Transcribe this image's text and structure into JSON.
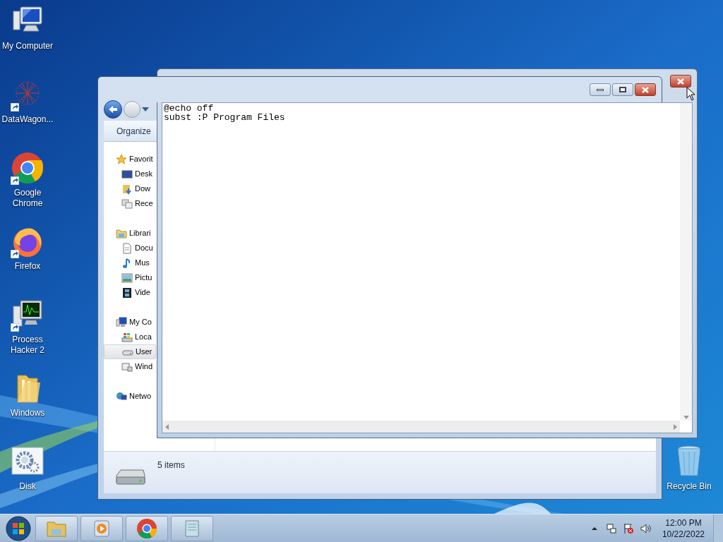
{
  "desktop_icons": [
    {
      "label": "My Computer",
      "kind": "computer",
      "shortcut": false
    },
    {
      "label": "DataWagon...",
      "kind": "web",
      "shortcut": true
    },
    {
      "label": "Google Chrome",
      "kind": "chrome",
      "shortcut": true
    },
    {
      "label": "Firefox",
      "kind": "firefox",
      "shortcut": true
    },
    {
      "label": "Process Hacker 2",
      "kind": "monitor",
      "shortcut": true
    },
    {
      "label": "Windows",
      "kind": "folder",
      "shortcut": false
    },
    {
      "label": "Disk",
      "kind": "gears",
      "shortcut": false
    }
  ],
  "recycle_bin": {
    "label": "Recycle Bin"
  },
  "explorer": {
    "toolbar": {
      "organize": "Organize"
    },
    "sidebar": [
      {
        "label": "Favorit",
        "kind": "star",
        "selected": false,
        "children": [
          {
            "label": "Desk",
            "kind": "desktop",
            "selected": false
          },
          {
            "label": "Dow",
            "kind": "download",
            "selected": false
          },
          {
            "label": "Rece",
            "kind": "recent",
            "selected": false
          }
        ]
      },
      {
        "label": "Librari",
        "kind": "library",
        "selected": false,
        "children": [
          {
            "label": "Docu",
            "kind": "document",
            "selected": false
          },
          {
            "label": "Mus",
            "kind": "music",
            "selected": false
          },
          {
            "label": "Pictu",
            "kind": "image",
            "selected": false
          },
          {
            "label": "Vide",
            "kind": "film",
            "selected": false
          }
        ]
      },
      {
        "label": "My Co",
        "kind": "computer",
        "selected": false,
        "children": [
          {
            "label": "Loca",
            "kind": "windrive",
            "selected": false
          },
          {
            "label": "User",
            "kind": "drive",
            "selected": true
          },
          {
            "label": "Wind",
            "kind": "xpdrive",
            "selected": false
          }
        ]
      },
      {
        "label": "Netwo",
        "kind": "network",
        "selected": false
      }
    ],
    "status": "5 items"
  },
  "notepad": {
    "lines": [
      "@echo off",
      "subst :P Program Files"
    ]
  },
  "taskbar": {
    "apps": [
      {
        "kind": "explorer"
      },
      {
        "kind": "media"
      },
      {
        "kind": "chrome"
      },
      {
        "kind": "notepad"
      }
    ],
    "tray": [
      {
        "kind": "arrow"
      },
      {
        "kind": "network"
      },
      {
        "kind": "flag"
      },
      {
        "kind": "speaker"
      }
    ],
    "time": "12:00 PM",
    "date": "10/22/2022"
  }
}
